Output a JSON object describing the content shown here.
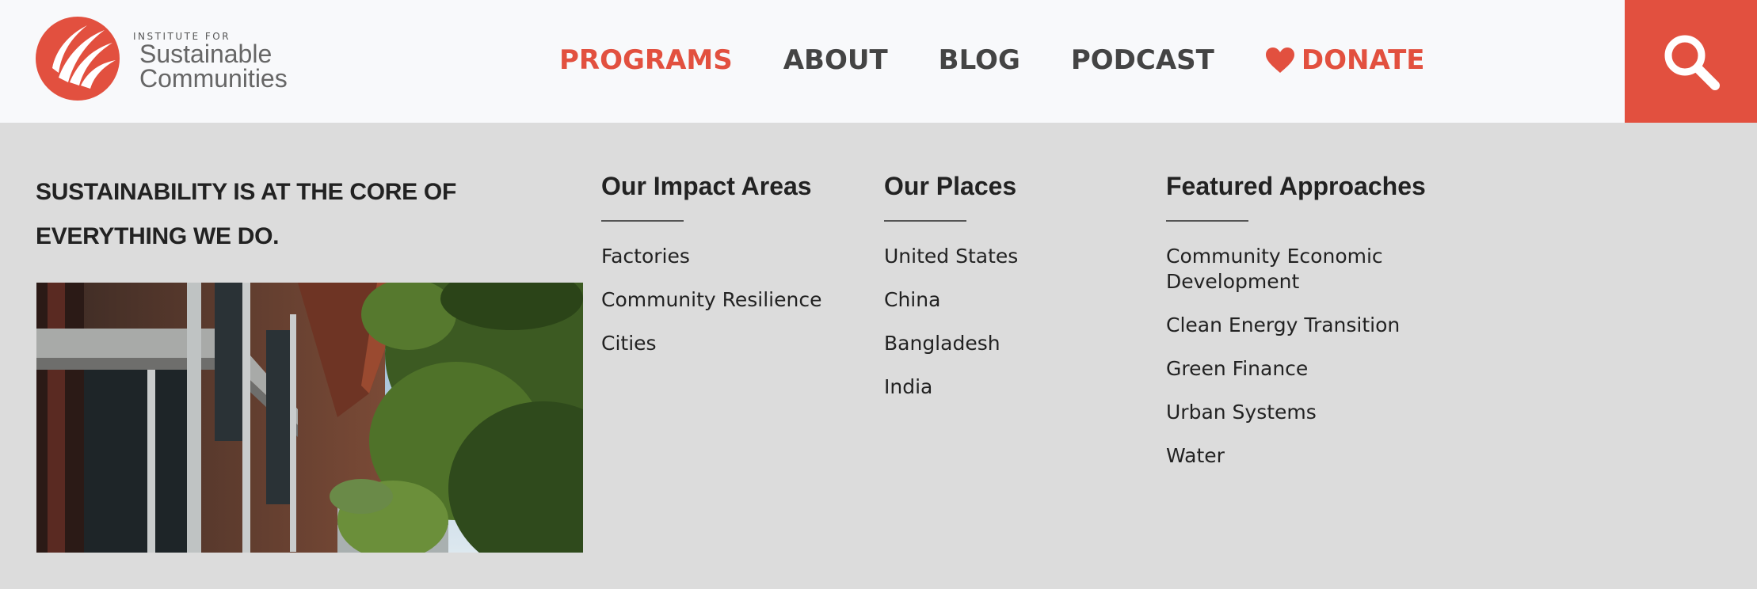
{
  "brand": {
    "small": "INSTITUTE FOR",
    "line1": "Sustainable",
    "line2": "Communities"
  },
  "nav": {
    "items": [
      {
        "label": "PROGRAMS",
        "active": true
      },
      {
        "label": "ABOUT",
        "active": false
      },
      {
        "label": "BLOG",
        "active": false
      },
      {
        "label": "PODCAST",
        "active": false
      }
    ],
    "donate_label": "DONATE",
    "donate_icon": "heart-icon",
    "search_icon": "search-icon"
  },
  "colors": {
    "accent": "#e2503f",
    "header_bg": "#f8f9fb",
    "menu_bg": "#dcdcdc",
    "nav_text": "#444444"
  },
  "mega_menu": {
    "tagline_line1": "SUSTAINABILITY IS AT THE CORE OF",
    "tagline_line2": "EVERYTHING WE DO.",
    "columns": [
      {
        "heading": "Our Impact Areas",
        "links": [
          "Factories",
          "Community Resilience",
          "Cities"
        ]
      },
      {
        "heading": "Our Places",
        "links": [
          "United States",
          "China",
          "Bangladesh",
          "India"
        ]
      },
      {
        "heading": "Featured Approaches",
        "links": [
          "Community Economic Development",
          "Clean Energy Transition",
          "Green Finance",
          "Urban Systems",
          "Water"
        ]
      }
    ],
    "featured_approaches_first_line1": "Community Economic",
    "featured_approaches_first_line2": "Development"
  }
}
